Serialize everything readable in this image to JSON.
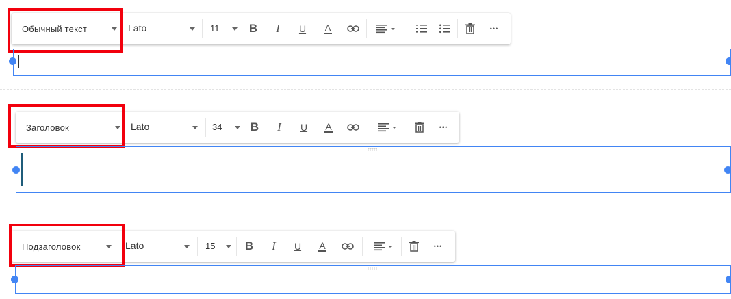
{
  "blocks": [
    {
      "style_label": "Обычный текст",
      "font_label": "Lato",
      "size_label": "11",
      "has_lists": true
    },
    {
      "style_label": "Заголовок",
      "font_label": "Lato",
      "size_label": "34",
      "has_lists": false
    },
    {
      "style_label": "Подзаголовок",
      "font_label": "Lato",
      "size_label": "15",
      "has_lists": false
    }
  ],
  "toolbar": {
    "bold_glyph": "B",
    "italic_glyph": "I",
    "underline_glyph": "U",
    "color_glyph": "A",
    "more_glyph": "•••"
  },
  "colors": {
    "accent": "#4285f4",
    "highlight": "#f2000d"
  }
}
